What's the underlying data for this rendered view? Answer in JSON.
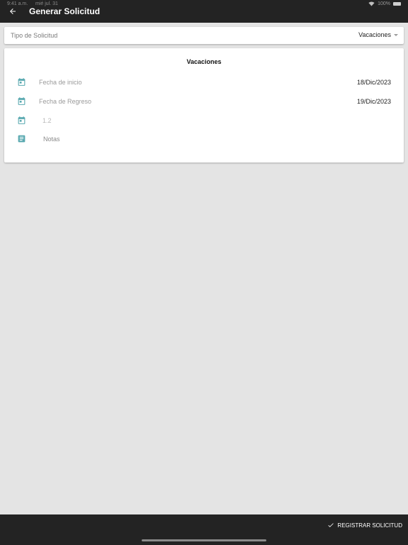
{
  "status_bar": {
    "time": "9:41 a.m.",
    "date": "mié jul. 31",
    "battery": "100%"
  },
  "header": {
    "title": "Generar Solicitud"
  },
  "request_type": {
    "label": "Tipo de Solicitud",
    "selected": "Vacaciones"
  },
  "form": {
    "title": "Vacaciones",
    "start_date": {
      "label": "Fecha de inicio",
      "value": "18/Dic/2023"
    },
    "return_date": {
      "label": "Fecha de Regreso",
      "value": "19/Dic/2023"
    },
    "days": {
      "value": "1.2"
    },
    "notes": {
      "label": "Notas"
    }
  },
  "footer": {
    "submit_label": "REGISTRAR SOLICITUD"
  },
  "colors": {
    "accent": "#5aa9b0",
    "bar": "#232323",
    "background": "#e4e4e4"
  }
}
